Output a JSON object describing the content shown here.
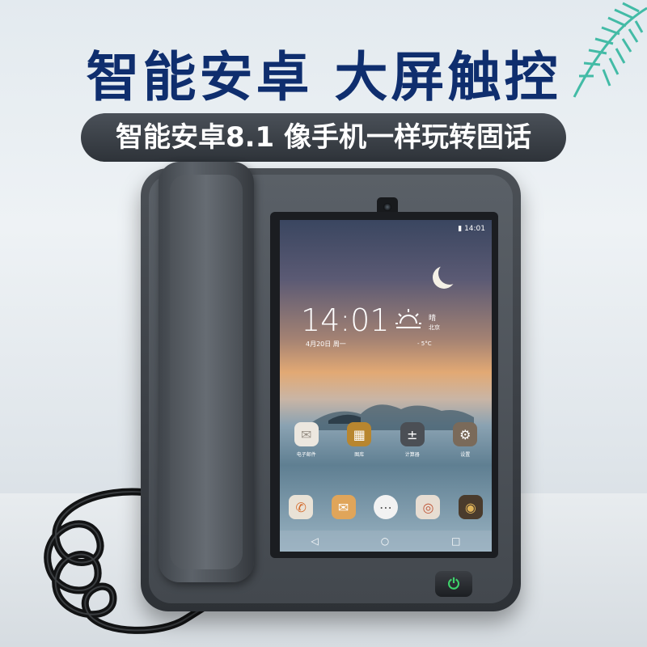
{
  "headline": "智能安卓 大屏触控",
  "subtitle": "智能安卓8.1 像手机一样玩转固话",
  "phone": {
    "screen": {
      "status_time": "14:01",
      "clock": "14:01",
      "date": "4月20日 周一",
      "weather": "晴",
      "city": "北京",
      "temperature": "- 5°C",
      "apps_row1": [
        {
          "label": "电子邮件",
          "icon": "mail-icon",
          "color": "#e9e4dc",
          "glyph": "✉"
        },
        {
          "label": "图库",
          "icon": "gallery-icon",
          "color": "#b8862f",
          "glyph": "▦"
        },
        {
          "label": "计算器",
          "icon": "calculator-icon",
          "color": "#4b4f55",
          "glyph": "±"
        },
        {
          "label": "设置",
          "icon": "settings-icon",
          "color": "#7a6a5a",
          "glyph": "⚙"
        }
      ],
      "apps_row2": [
        {
          "label": "",
          "icon": "phone-icon",
          "color": "#e9e2d6",
          "glyph": "✆"
        },
        {
          "label": "",
          "icon": "messages-icon",
          "color": "#e0a55a",
          "glyph": "✉"
        },
        {
          "label": "",
          "icon": "app-drawer-icon",
          "color": "#f2f2f2",
          "glyph": "⋯"
        },
        {
          "label": "",
          "icon": "browser-icon",
          "color": "#e7ddd2",
          "glyph": "◎"
        },
        {
          "label": "",
          "icon": "camera-icon",
          "color": "#4a3b2c",
          "glyph": "◉"
        }
      ],
      "nav": {
        "back": "◁",
        "home": "○",
        "recent": "□"
      }
    },
    "power_glyph": "⏻"
  }
}
